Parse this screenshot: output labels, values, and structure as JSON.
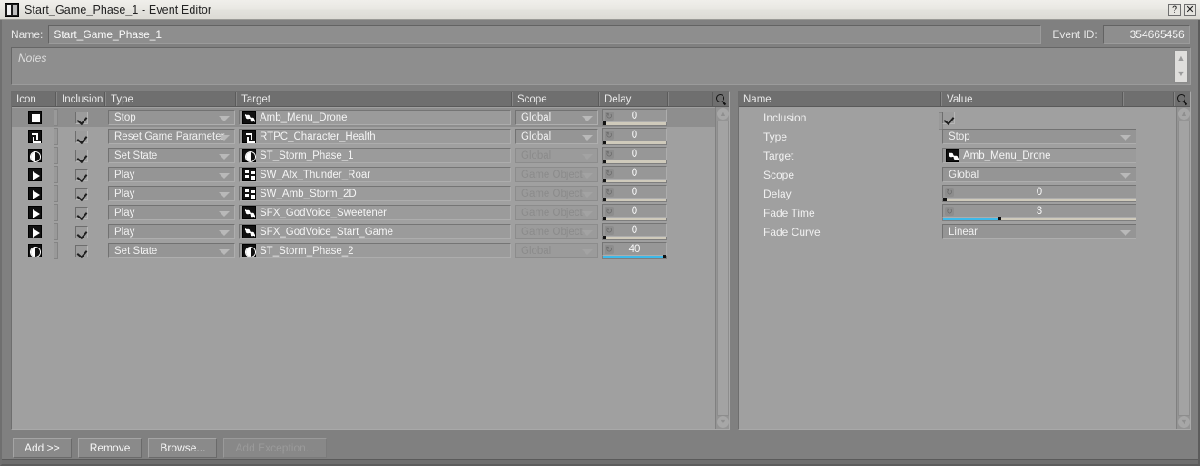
{
  "window": {
    "title": "Start_Game_Phase_1 - Event Editor",
    "icon": "event-editor-icon",
    "help_label": "?",
    "close_label": "✕"
  },
  "header": {
    "name_label": "Name:",
    "name_value": "Start_Game_Phase_1",
    "event_id_label": "Event ID:",
    "event_id_value": "354665456",
    "notes_placeholder": "Notes",
    "notes_value": ""
  },
  "action_list": {
    "columns": [
      {
        "key": "icon",
        "label": "Icon"
      },
      {
        "key": "inclusion",
        "label": "Inclusion"
      },
      {
        "key": "type",
        "label": "Type"
      },
      {
        "key": "target",
        "label": "Target"
      },
      {
        "key": "scope",
        "label": "Scope"
      },
      {
        "key": "delay",
        "label": "Delay"
      }
    ],
    "search_icon": "search-icon",
    "rows": [
      {
        "icon": "stop",
        "inclusion": true,
        "type": "Stop",
        "type_enabled": true,
        "target_icon": "sfx-object-icon",
        "target": "Amb_Menu_Drone",
        "scope": "Global",
        "scope_enabled": true,
        "delay": "0",
        "delay_fill_pct": 0,
        "selected": true
      },
      {
        "icon": "rtpc",
        "inclusion": true,
        "type": "Reset Game Parameter",
        "type_enabled": true,
        "target_icon": "game-parameter-icon",
        "target": "RTPC_Character_Health",
        "scope": "Global",
        "scope_enabled": true,
        "delay": "0",
        "delay_fill_pct": 0,
        "selected": false
      },
      {
        "icon": "state",
        "inclusion": true,
        "type": "Set State",
        "type_enabled": true,
        "target_icon": "state-icon",
        "target": "ST_Storm_Phase_1",
        "scope": "Global",
        "scope_enabled": false,
        "delay": "0",
        "delay_fill_pct": 0,
        "selected": false
      },
      {
        "icon": "play",
        "inclusion": true,
        "type": "Play",
        "type_enabled": true,
        "target_icon": "switch-container-icon",
        "target": "SW_Afx_Thunder_Roar",
        "scope": "Game Object",
        "scope_enabled": false,
        "delay": "0",
        "delay_fill_pct": 0,
        "selected": false
      },
      {
        "icon": "play",
        "inclusion": true,
        "type": "Play",
        "type_enabled": true,
        "target_icon": "switch-container-icon",
        "target": "SW_Amb_Storm_2D",
        "scope": "Game Object",
        "scope_enabled": false,
        "delay": "0",
        "delay_fill_pct": 0,
        "selected": false
      },
      {
        "icon": "play",
        "inclusion": true,
        "type": "Play",
        "type_enabled": true,
        "target_icon": "sfx-object-icon",
        "target": "SFX_GodVoice_Sweetener",
        "scope": "Game Object",
        "scope_enabled": false,
        "delay": "0",
        "delay_fill_pct": 0,
        "selected": false
      },
      {
        "icon": "play",
        "inclusion": true,
        "type": "Play",
        "type_enabled": true,
        "target_icon": "sfx-object-icon",
        "target": "SFX_GodVoice_Start_Game",
        "scope": "Game Object",
        "scope_enabled": false,
        "delay": "0",
        "delay_fill_pct": 0,
        "selected": false
      },
      {
        "icon": "state",
        "inclusion": true,
        "type": "Set State",
        "type_enabled": true,
        "target_icon": "state-icon",
        "target": "ST_Storm_Phase_2",
        "scope": "Global",
        "scope_enabled": false,
        "delay": "40",
        "delay_fill_pct": 100,
        "selected": false
      }
    ]
  },
  "properties": {
    "columns": [
      {
        "key": "name",
        "label": "Name"
      },
      {
        "key": "value",
        "label": "Value"
      }
    ],
    "search_icon": "search-icon",
    "rows": [
      {
        "name": "Inclusion",
        "kind": "checkbox",
        "value": true
      },
      {
        "name": "Type",
        "kind": "combo",
        "value": "Stop"
      },
      {
        "name": "Target",
        "kind": "target",
        "value": "Amb_Menu_Drone",
        "icon": "sfx-object-icon"
      },
      {
        "name": "Scope",
        "kind": "combo",
        "value": "Global"
      },
      {
        "name": "Delay",
        "kind": "slider",
        "value": "0",
        "fill_pct": 0
      },
      {
        "name": "Fade Time",
        "kind": "slider",
        "value": "3",
        "fill_pct": 30
      },
      {
        "name": "Fade Curve",
        "kind": "combo",
        "value": "Linear"
      }
    ]
  },
  "buttons": [
    {
      "label": "Add >>",
      "enabled": true,
      "name": "add-button"
    },
    {
      "label": "Remove",
      "enabled": true,
      "name": "remove-button"
    },
    {
      "label": "Browse...",
      "enabled": true,
      "name": "browse-button"
    },
    {
      "label": "Add Exception...",
      "enabled": false,
      "name": "add-exception-button"
    }
  ],
  "colors": {
    "accent": "#3fb9e8",
    "panel_bg": "#a0a0a0",
    "window_bg": "#808080",
    "header_bg": "#6f6f6f",
    "titlebar_bg": "#e9e8e3"
  }
}
